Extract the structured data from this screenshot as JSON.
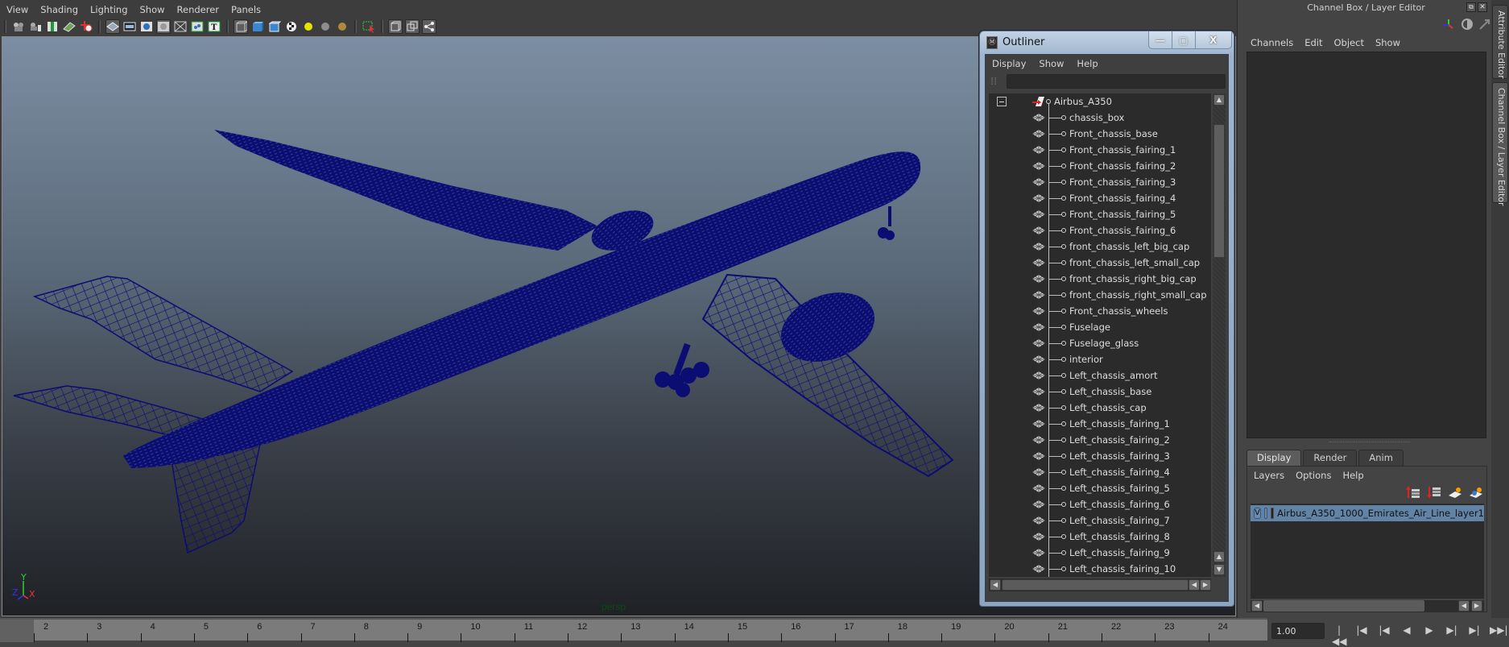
{
  "viewport_panel": {
    "menu": [
      "View",
      "Shading",
      "Lighting",
      "Show",
      "Renderer",
      "Panels"
    ],
    "toolbar_icons": [
      "camera-icon",
      "camera-attributes-icon",
      "bookmark-icon",
      "image-plane-icon",
      "2d-pan-zoom-icon",
      "grid-icon",
      "film-gate-icon",
      "resolution-gate-icon",
      "gate-mask-icon",
      "field-chart-icon",
      "safe-action-icon",
      "safe-title-icon",
      "wireframe-icon",
      "smooth-shade-icon",
      "wireframe-on-shaded-icon",
      "textured-icon",
      "use-all-lights-icon",
      "shadows-icon",
      "ambient-occlusion-icon",
      "isolate-select-icon",
      "xray-icon",
      "xray-joints-icon",
      "hud-icon"
    ],
    "camera_label": "persp",
    "axis": {
      "x": "X",
      "y": "Y",
      "z": "Z"
    },
    "wire_color": "#0b0d73",
    "background_top": "#7c8ea3",
    "background_bottom": "#1f2125"
  },
  "outliner": {
    "title": "Outliner",
    "menu": [
      "Display",
      "Show",
      "Help"
    ],
    "search_value": "",
    "root": "Airbus_A350",
    "items": [
      "chassis_box",
      "Front_chassis_base",
      "Front_chassis_fairing_1",
      "Front_chassis_fairing_2",
      "Front_chassis_fairing_3",
      "Front_chassis_fairing_4",
      "Front_chassis_fairing_5",
      "Front_chassis_fairing_6",
      "front_chassis_left_big_cap",
      "front_chassis_left_small_cap",
      "front_chassis_right_big_cap",
      "front_chassis_right_small_cap",
      "Front_chassis_wheels",
      "Fuselage",
      "Fuselage_glass",
      "interior",
      "Left_chassis_amort",
      "Left_chassis_base",
      "Left_chassis_cap",
      "Left_chassis_fairing_1",
      "Left_chassis_fairing_2",
      "Left_chassis_fairing_3",
      "Left_chassis_fairing_4",
      "Left_chassis_fairing_5",
      "Left_chassis_fairing_6",
      "Left_chassis_fairing_7",
      "Left_chassis_fairing_8",
      "Left_chassis_fairing_9",
      "Left_chassis_fairing_10"
    ],
    "window_buttons": {
      "minimize": "—",
      "maximize": "▢",
      "close": "X"
    }
  },
  "channel_box": {
    "title": "Channel Box / Layer Editor",
    "menu": [
      "Channels",
      "Edit",
      "Object",
      "Show"
    ],
    "float_btn": "⧉",
    "close_btn": "✕"
  },
  "layer_editor": {
    "tabs": [
      {
        "label": "Display",
        "active": true
      },
      {
        "label": "Render",
        "active": false
      },
      {
        "label": "Anim",
        "active": false
      }
    ],
    "menu": [
      "Layers",
      "Options",
      "Help"
    ],
    "layers": [
      {
        "visible": "V",
        "playback": "",
        "name": "Airbus_A350_1000_Emirates_Air_Line_layer1",
        "selected": true
      }
    ]
  },
  "side_tabs": [
    "Attribute Editor",
    "Channel Box / Layer Editor"
  ],
  "timeline": {
    "ticks": [
      2,
      3,
      4,
      5,
      6,
      7,
      8,
      9,
      10,
      11,
      12,
      13,
      14,
      15,
      16,
      17,
      18,
      19,
      20,
      21,
      22,
      23,
      24
    ],
    "current_frame": "1.00"
  },
  "playback": {
    "buttons": [
      "go-to-start",
      "step-back-frame",
      "step-back-key",
      "play-backwards",
      "play-forwards",
      "step-forward-key",
      "step-forward-frame",
      "go-to-end"
    ],
    "glyphs": [
      "|◀◀",
      "|◀",
      "|◀",
      "◀",
      "▶",
      "▶|",
      "▶|",
      "▶▶|"
    ]
  }
}
